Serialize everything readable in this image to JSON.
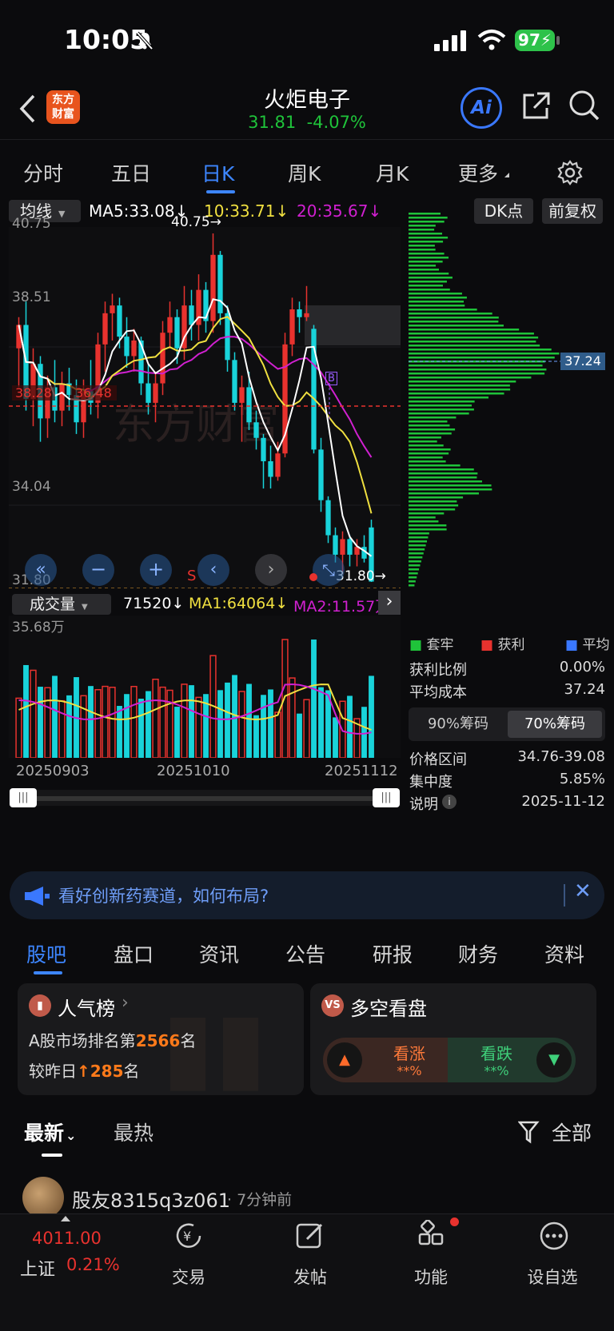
{
  "status": {
    "time": "10:05",
    "battery": "97"
  },
  "header": {
    "title": "火炬电子",
    "price": "31.81",
    "change": "-4.07%",
    "logo_line1": "东方",
    "logo_line2": "财富",
    "ai": "Ai"
  },
  "period_tabs": [
    "分时",
    "五日",
    "日K",
    "周K",
    "月K",
    "更多"
  ],
  "ma_bar": {
    "selector": "均线",
    "ma5": "MA5:33.08",
    "ma10": "10:33.71",
    "ma20": "20:35.67",
    "dk": "DK点",
    "fq": "前复权"
  },
  "price_chart": {
    "y_labels": [
      "40.75",
      "38.51",
      "34.04",
      "31.80"
    ],
    "high_marker": "40.75→",
    "low_marker": "31.80→",
    "ref_line": "36.48",
    "ref_left": "38.28",
    "s_marker": "S",
    "b_marker": "B",
    "watermark": "东方财富",
    "cost_badge": "37.24"
  },
  "chart_data": {
    "type": "candlestick",
    "dates_shown": [
      "20250903",
      "20251010",
      "20251112"
    ],
    "ma_labels": [
      "MA5:33.08",
      "10:33.71",
      "20:35.67"
    ],
    "price_range": [
      31.8,
      40.75
    ],
    "candles": [
      [
        37.8,
        38.6,
        36.8,
        38.4
      ],
      [
        38.4,
        39.0,
        36.2,
        36.5
      ],
      [
        36.5,
        37.8,
        35.8,
        37.4
      ],
      [
        37.4,
        37.6,
        35.4,
        36.0
      ],
      [
        36.0,
        37.1,
        35.5,
        36.8
      ],
      [
        36.8,
        37.5,
        35.9,
        36.2
      ],
      [
        36.2,
        37.2,
        35.8,
        36.9
      ],
      [
        36.9,
        37.3,
        36.2,
        36.6
      ],
      [
        36.6,
        37.0,
        35.6,
        35.9
      ],
      [
        35.9,
        37.0,
        35.5,
        36.7
      ],
      [
        36.7,
        37.5,
        36.1,
        36.4
      ],
      [
        36.4,
        38.2,
        36.0,
        37.9
      ],
      [
        37.9,
        39.0,
        37.2,
        38.7
      ],
      [
        38.7,
        39.2,
        38.0,
        38.9
      ],
      [
        38.9,
        39.1,
        37.8,
        38.1
      ],
      [
        38.1,
        38.6,
        37.3,
        37.6
      ],
      [
        37.6,
        38.3,
        37.2,
        38.0
      ],
      [
        38.0,
        38.1,
        36.6,
        36.9
      ],
      [
        36.9,
        37.4,
        36.1,
        36.4
      ],
      [
        36.4,
        37.2,
        35.9,
        36.9
      ],
      [
        36.9,
        38.5,
        36.6,
        38.2
      ],
      [
        38.2,
        39.0,
        37.8,
        38.6
      ],
      [
        38.6,
        38.8,
        37.4,
        37.8
      ],
      [
        37.8,
        39.4,
        37.5,
        38.9
      ],
      [
        38.9,
        39.3,
        38.0,
        38.4
      ],
      [
        38.4,
        39.7,
        38.0,
        39.3
      ],
      [
        39.3,
        39.5,
        38.2,
        38.5
      ],
      [
        38.5,
        40.75,
        38.2,
        40.2
      ],
      [
        40.2,
        40.3,
        38.4,
        38.7
      ],
      [
        38.7,
        38.9,
        37.2,
        37.5
      ],
      [
        37.5,
        37.7,
        36.2,
        36.4
      ],
      [
        36.4,
        37.1,
        35.4,
        36.8
      ],
      [
        36.8,
        37.2,
        35.7,
        35.9
      ],
      [
        35.9,
        36.2,
        35.2,
        35.5
      ],
      [
        35.5,
        35.6,
        34.2,
        34.9
      ],
      [
        34.9,
        35.3,
        34.2,
        34.5
      ],
      [
        34.5,
        35.4,
        34.4,
        35.1
      ],
      [
        35.1,
        38.2,
        35.0,
        37.9
      ],
      [
        37.9,
        39.1,
        37.6,
        38.8
      ],
      [
        38.8,
        39.0,
        38.2,
        38.6
      ],
      [
        38.6,
        39.4,
        38.5,
        38.7
      ],
      [
        38.3,
        38.4,
        35.1,
        35.2
      ],
      [
        35.2,
        35.5,
        33.6,
        33.9
      ],
      [
        33.9,
        34.0,
        32.8,
        33.0
      ],
      [
        33.0,
        33.2,
        32.3,
        32.5
      ],
      [
        32.5,
        33.1,
        32.0,
        32.9
      ],
      [
        32.9,
        33.0,
        32.2,
        32.5
      ],
      [
        32.5,
        32.9,
        32.2,
        32.7
      ],
      [
        32.7,
        33.0,
        32.3,
        32.4
      ],
      [
        33.2,
        33.4,
        31.8,
        31.81
      ]
    ],
    "volume_max": "35.68万"
  },
  "volume_bar": {
    "selector": "成交量",
    "vol": "71520",
    "ma1": "MA1:64064",
    "ma2": "MA2:11.57万",
    "max": "35.68万"
  },
  "dates": [
    "20250903",
    "20251010",
    "20251112"
  ],
  "chip": {
    "legend": [
      "套牢",
      "获利",
      "平均"
    ],
    "rows": [
      {
        "label": "获利比例",
        "value": "0.00%"
      },
      {
        "label": "平均成本",
        "value": "37.24"
      }
    ],
    "toggle": [
      "90%筹码",
      "70%筹码"
    ],
    "rows2": [
      {
        "label": "价格区间",
        "value": "34.76-39.08"
      },
      {
        "label": "集中度",
        "value": "5.85%"
      },
      {
        "label": "说明",
        "value": "2025-11-12"
      }
    ]
  },
  "banner": {
    "text": "看好创新药赛道，如何布局?"
  },
  "section_tabs": [
    "股吧",
    "盘口",
    "资讯",
    "公告",
    "研报",
    "财务",
    "资料"
  ],
  "popularity": {
    "title": "人气榜",
    "line1_prefix": "A股市场排名第",
    "rank": "2566",
    "line1_suffix": "名",
    "line2_prefix": "较昨日",
    "delta": "285",
    "line2_suffix": "名"
  },
  "bullbear": {
    "title": "多空看盘",
    "up_label": "看涨",
    "up_value": "**%",
    "down_label": "看跌",
    "down_value": "**%"
  },
  "feed_tabs": {
    "latest": "最新",
    "hot": "最热",
    "filter": "全部"
  },
  "post": {
    "user": "股友8315q3z061",
    "time": "7分钟前"
  },
  "bottom": {
    "index_value": "4011.00",
    "index_name": "上证",
    "index_change": "0.21%",
    "trade": "交易",
    "post": "发帖",
    "func": "功能",
    "watch": "设自选"
  },
  "colors": {
    "up": "#e8322e",
    "down": "#19d3da",
    "green": "#1fc33a",
    "ma5": "#ffffff",
    "ma10": "#f0e040",
    "ma20": "#d020d0",
    "accent": "#2f78ff"
  }
}
